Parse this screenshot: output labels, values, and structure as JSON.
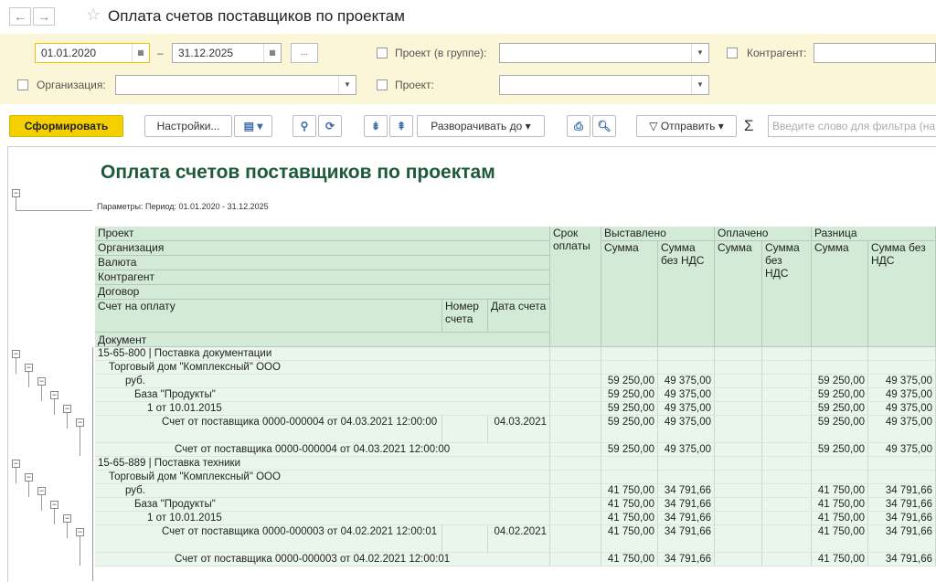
{
  "window": {
    "title": "Оплата счетов поставщиков по проектам"
  },
  "filters": {
    "date_from": "01.01.2020",
    "date_to": "31.12.2025",
    "dash": "–",
    "more_btn": "...",
    "project_group_label": "Проект (в группе):",
    "counterparty_label": "Контрагент:",
    "organization_label": "Организация:",
    "project_label": "Проект:"
  },
  "toolbar": {
    "generate": "Сформировать",
    "settings": "Настройки...",
    "expand_to": "Разворачивать до",
    "send": "Отправить",
    "sigma": "Σ",
    "filter_placeholder": "Введите слово для фильтра (на"
  },
  "report": {
    "title": "Оплата счетов поставщиков по проектам",
    "params": "Параметры: Период: 01.01.2020 - 31.12.2025",
    "headers": {
      "project": "Проект",
      "organization": "Организация",
      "currency": "Валюта",
      "counterparty": "Контрагент",
      "contract": "Договор",
      "invoice": "Счет на оплату",
      "invoice_no": "Номер счета",
      "invoice_date": "Дата счета",
      "document": "Документ",
      "due": "Срок оплаты",
      "issued": "Выставлено",
      "paid": "Оплачено",
      "diff": "Разница",
      "sum": "Сумма",
      "sum_no_vat": "Сумма без НДС",
      "sum_no_vat_paid": "Сумма без НДС"
    },
    "rows": [
      {
        "label": "15-65-800 | Поставка документации",
        "indent": 0,
        "issued": "",
        "issued_nv": "",
        "diff": "",
        "diff_nv": "",
        "date": ""
      },
      {
        "label": "Торговый дом \"Комплексный\" ООО",
        "indent": 1,
        "issued": "",
        "issued_nv": "",
        "diff": "",
        "diff_nv": "",
        "date": ""
      },
      {
        "label": "руб.",
        "indent": 2,
        "issued": "59 250,00",
        "issued_nv": "49 375,00",
        "diff": "59 250,00",
        "diff_nv": "49 375,00",
        "date": ""
      },
      {
        "label": "База \"Продукты\"",
        "indent": 3,
        "issued": "59 250,00",
        "issued_nv": "49 375,00",
        "diff": "59 250,00",
        "diff_nv": "49 375,00",
        "date": ""
      },
      {
        "label": "1 от 10.01.2015",
        "indent": 4,
        "issued": "59 250,00",
        "issued_nv": "49 375,00",
        "diff": "59 250,00",
        "diff_nv": "49 375,00",
        "date": ""
      },
      {
        "label": "Счет от поставщика 0000-000004 от 04.03.2021 12:00:00",
        "indent": 5,
        "issued": "59 250,00",
        "issued_nv": "49 375,00",
        "diff": "59 250,00",
        "diff_nv": "49 375,00",
        "date": "04.03.2021",
        "tall": true
      },
      {
        "label": "Счет от поставщика 0000-000004 от 04.03.2021 12:00:00",
        "indent": 6,
        "issued": "59 250,00",
        "issued_nv": "49 375,00",
        "diff": "59 250,00",
        "diff_nv": "49 375,00",
        "date": ""
      },
      {
        "label": "15-65-889 | Поставка техники",
        "indent": 0,
        "issued": "",
        "issued_nv": "",
        "diff": "",
        "diff_nv": "",
        "date": ""
      },
      {
        "label": "Торговый дом \"Комплексный\" ООО",
        "indent": 1,
        "issued": "",
        "issued_nv": "",
        "diff": "",
        "diff_nv": "",
        "date": ""
      },
      {
        "label": "руб.",
        "indent": 2,
        "issued": "41 750,00",
        "issued_nv": "34 791,66",
        "diff": "41 750,00",
        "diff_nv": "34 791,66",
        "date": ""
      },
      {
        "label": "База \"Продукты\"",
        "indent": 3,
        "issued": "41 750,00",
        "issued_nv": "34 791,66",
        "diff": "41 750,00",
        "diff_nv": "34 791,66",
        "date": ""
      },
      {
        "label": "1 от 10.01.2015",
        "indent": 4,
        "issued": "41 750,00",
        "issued_nv": "34 791,66",
        "diff": "41 750,00",
        "diff_nv": "34 791,66",
        "date": ""
      },
      {
        "label": "Счет от поставщика 0000-000003 от 04.02.2021 12:00:01",
        "indent": 5,
        "issued": "41 750,00",
        "issued_nv": "34 791,66",
        "diff": "41 750,00",
        "diff_nv": "34 791,66",
        "date": "04.02.2021",
        "tall": true
      },
      {
        "label": "Счет от поставщика 0000-000003 от 04.02.2021 12:00:01",
        "indent": 6,
        "issued": "41 750,00",
        "issued_nv": "34 791,66",
        "diff": "41 750,00",
        "diff_nv": "34 791,66",
        "date": ""
      }
    ]
  },
  "colors": {
    "accent": "#f5d000",
    "header_bg": "#d3ead7",
    "title_green": "#1d5a3c"
  }
}
